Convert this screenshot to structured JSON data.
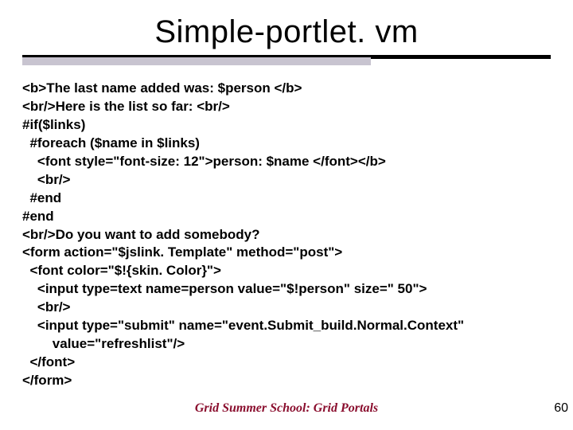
{
  "title": "Simple-portlet. vm",
  "code_lines": [
    "<b>The last name added was: $person </b>",
    "<br/>Here is the list so far: <br/>",
    "#if($links)",
    "  #foreach ($name in $links)",
    "    <font style=\"font-size: 12\">person: $name </font></b>",
    "    <br/>",
    "  #end",
    "#end",
    "<br/>Do you want to add somebody?",
    "<form action=\"$jslink. Template\" method=\"post\">",
    "  <font color=\"$!{skin. Color}\">",
    "    <input type=text name=person value=\"$!person\" size=\" 50\">",
    "    <br/>",
    "    <input type=\"submit\" name=\"event.Submit_build.Normal.Context\"",
    "        value=\"refreshlist\"/>",
    "  </font>",
    "</form>"
  ],
  "footer": "Grid Summer School: Grid Portals",
  "page_number": "60"
}
